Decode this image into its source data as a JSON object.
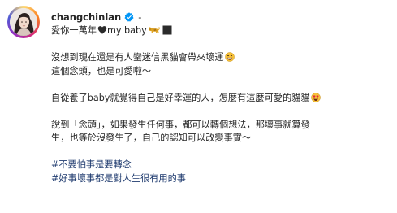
{
  "post": {
    "username": "changchinlan",
    "separator": "-",
    "title_text": "愛你一萬年",
    "title_suffix": "my baby",
    "lines": {
      "p1_l1": "沒想到現在還是有人蠻迷信黑貓會帶來壞運",
      "p1_l2": "這個念頭，也是可愛啦～",
      "p2_l1": "自從養了baby就覺得自己是好幸運的人，怎麼有這麼可愛的貓貓",
      "p3_l1": "說到「念頭」，如果發生任何事，都可以轉個想法，那壞事就算發",
      "p3_l2": "生，也等於沒發生了，自己的認知可以改變事實～",
      "tag1": "#不要怕事是要轉念",
      "tag2": "#好事壞事都是對人生很有用的事"
    }
  },
  "icons": {
    "verified": "verified-badge-icon",
    "heart": "black-heart-icon",
    "cat": "cat-icon",
    "square": "black-square-icon",
    "grin": "grinning-face-icon",
    "heart_eyes": "heart-eyes-face-icon"
  },
  "colors": {
    "text": "#262626",
    "hashtag": "#1e3a6e",
    "verified": "#0095f6"
  }
}
